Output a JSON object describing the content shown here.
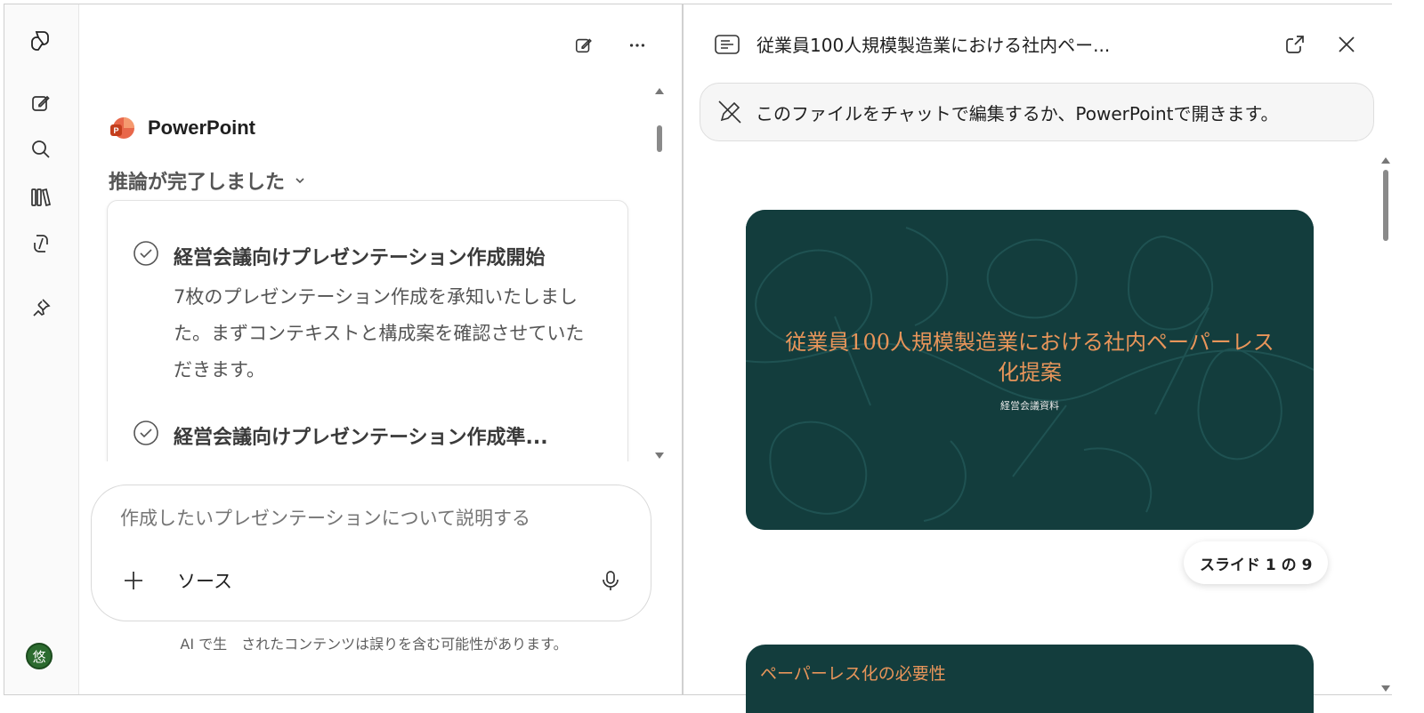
{
  "app": {
    "colors": {
      "accent_orange": "#e8955a",
      "slide_bg": "#133d3d",
      "avatar_bg": "#2c6b2f"
    }
  },
  "rail": {
    "icons": [
      "copilot-logo-icon",
      "new-chat-icon",
      "search-icon",
      "library-icon",
      "copilot-code-icon",
      "pin-icon"
    ],
    "avatar_initial": "悠"
  },
  "chat": {
    "agent_name": "PowerPoint",
    "reasoning_label": "推論が完了しました",
    "steps": [
      {
        "title": "経営会議向けプレゼンテーション作成開始",
        "body": "7枚のプレゼンテーション作成を承知いたしました。まずコンテキストと構成案を確認させていただきます。"
      },
      {
        "title": "経営会議向けプレゼンテーション作成準..."
      }
    ],
    "composer": {
      "placeholder": "作成したいプレゼンテーションについて説明する",
      "source_label": "ソース"
    },
    "disclaimer": "AI で生　されたコンテンツは誤りを含む可能性があります。"
  },
  "preview": {
    "title": "従業員100人規模製造業における社内ペー...",
    "notice": "このファイルをチャットで編集するか、PowerPointで開きます。",
    "slides": [
      {
        "title": "従業員100人規模製造業における社内ペーパーレス化提案",
        "subtitle": "経営会議資料"
      },
      {
        "title": "ペーパーレス化の必要性"
      }
    ],
    "slide_counter": "スライド 1 の 9"
  }
}
